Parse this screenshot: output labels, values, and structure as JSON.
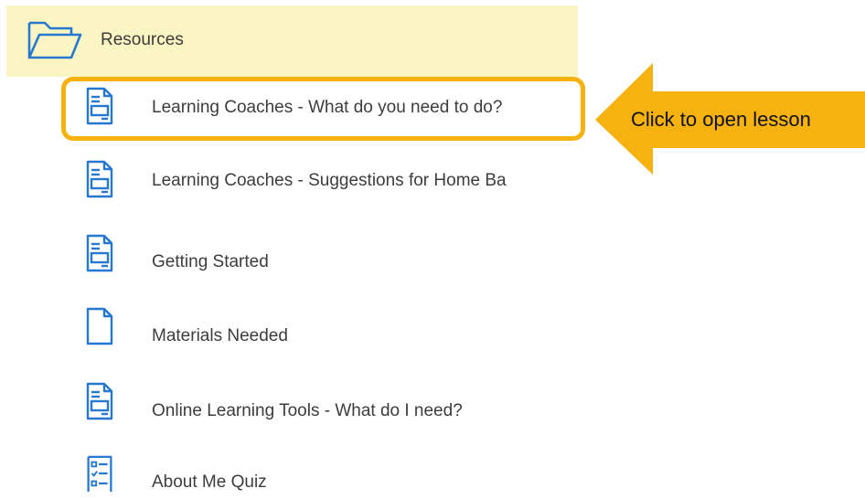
{
  "folder": {
    "label": "Resources",
    "icon": "folder-open-icon"
  },
  "items": [
    {
      "label": "Learning Coaches - What do you need to do?",
      "icon": "document-lines-icon"
    },
    {
      "label": "Learning Coaches - Suggestions for Home Ba",
      "icon": "document-lines-icon"
    },
    {
      "label": "Getting Started",
      "icon": "document-lines-icon"
    },
    {
      "label": "Materials Needed",
      "icon": "document-blank-icon"
    },
    {
      "label": "Online Learning Tools - What do I need?",
      "icon": "document-lines-icon"
    },
    {
      "label": "About Me Quiz",
      "icon": "quiz-checklist-icon"
    }
  ],
  "callout": {
    "text": "Click to open lesson"
  },
  "colors": {
    "icon_blue": "#2778d0",
    "folder_row_bg": "#fbf5c3",
    "callout_orange": "#f6b20e",
    "text": "#3d3d3d"
  }
}
